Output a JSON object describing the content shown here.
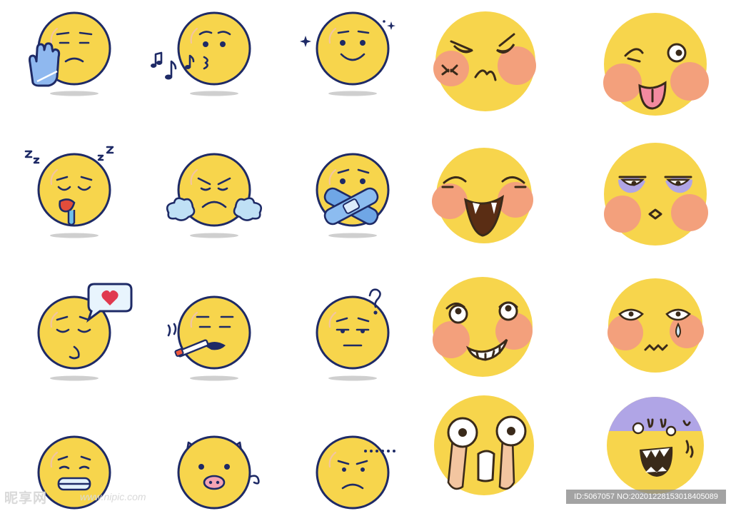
{
  "watermark": {
    "brand": "昵享网",
    "url": "www.nipic.com",
    "id_text": "ID:5067057 NO:20201228153018405089"
  },
  "colors": {
    "face": "#f7d54c",
    "outline": "#1e2a66",
    "blush": "#f3a07c",
    "accent_blue": "#6fa6e6",
    "heart": "#e0394f",
    "pig_pink": "#f4a4b4",
    "bruise_purple": "#b0a5e6",
    "shadow": "#cccccc"
  },
  "grid": {
    "rows": 4,
    "columns": 5,
    "style_left_three_columns": "outlined emoji stickers",
    "style_right_two_columns": "borderless cartoon emoji faces"
  },
  "emojis": [
    {
      "row": 1,
      "col": 1,
      "icon": "stop-hand-annoyed-emoji-icon"
    },
    {
      "row": 1,
      "col": 2,
      "icon": "whistling-kiss-emoji-icon"
    },
    {
      "row": 1,
      "col": 3,
      "icon": "sparkle-smile-emoji-icon"
    },
    {
      "row": 1,
      "col": 4,
      "icon": "angry-pout-emoji-icon"
    },
    {
      "row": 1,
      "col": 5,
      "icon": "wink-tongue-emoji-icon"
    },
    {
      "row": 2,
      "col": 1,
      "icon": "sleeping-drool-emoji-icon"
    },
    {
      "row": 2,
      "col": 2,
      "icon": "fuming-emoji-icon"
    },
    {
      "row": 2,
      "col": 3,
      "icon": "bandaged-mouth-emoji-icon"
    },
    {
      "row": 2,
      "col": 4,
      "icon": "laughing-fang-emoji-icon"
    },
    {
      "row": 2,
      "col": 5,
      "icon": "unamused-eyebags-emoji-icon"
    },
    {
      "row": 3,
      "col": 1,
      "icon": "love-message-emoji-icon"
    },
    {
      "row": 3,
      "col": 2,
      "icon": "smoking-emoji-icon"
    },
    {
      "row": 3,
      "col": 3,
      "icon": "confused-question-emoji-icon"
    },
    {
      "row": 3,
      "col": 4,
      "icon": "grinning-sly-emoji-icon"
    },
    {
      "row": 3,
      "col": 5,
      "icon": "crying-wavy-mouth-emoji-icon"
    },
    {
      "row": 4,
      "col": 1,
      "icon": "grimace-emoji-icon"
    },
    {
      "row": 4,
      "col": 2,
      "icon": "pig-emoji-icon"
    },
    {
      "row": 4,
      "col": 3,
      "icon": "speechless-ellipsis-emoji-icon"
    },
    {
      "row": 4,
      "col": 4,
      "icon": "shocked-tears-emoji-icon"
    },
    {
      "row": 4,
      "col": 5,
      "icon": "horrified-scream-emoji-icon"
    }
  ]
}
